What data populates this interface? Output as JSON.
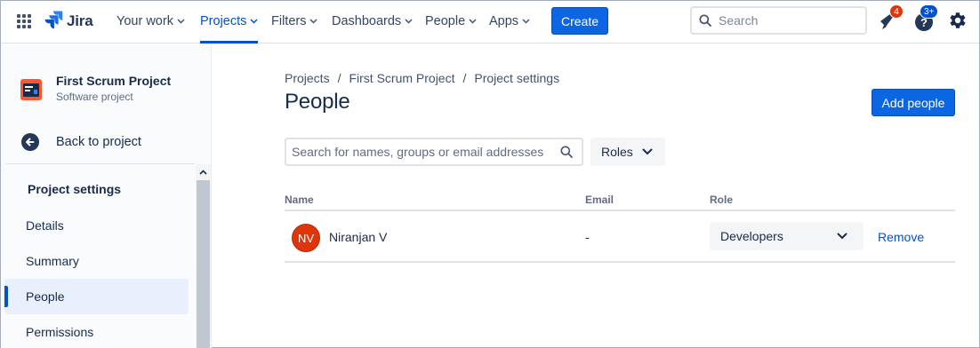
{
  "topnav": {
    "app_name": "Jira",
    "items": [
      {
        "label": "Your work",
        "active": false
      },
      {
        "label": "Projects",
        "active": true
      },
      {
        "label": "Filters",
        "active": false
      },
      {
        "label": "Dashboards",
        "active": false
      },
      {
        "label": "People",
        "active": false
      },
      {
        "label": "Apps",
        "active": false
      }
    ],
    "create_label": "Create",
    "search_placeholder": "Search",
    "notifications_badge": "4",
    "help_badge": "3+",
    "icons": [
      "app-switcher-icon",
      "jira-logo-icon",
      "search-icon",
      "notifications-icon",
      "help-icon",
      "settings-icon"
    ],
    "colors": {
      "accent": "#0c66e4",
      "notification_badge": "#de350b",
      "help_badge": "#0052cc"
    }
  },
  "sidebar": {
    "project_name": "First Scrum Project",
    "project_type": "Software project",
    "back_label": "Back to project",
    "section_heading": "Project settings",
    "items": [
      {
        "label": "Details",
        "selected": false
      },
      {
        "label": "Summary",
        "selected": false
      },
      {
        "label": "People",
        "selected": true
      },
      {
        "label": "Permissions",
        "selected": false
      }
    ]
  },
  "main": {
    "breadcrumbs": [
      "Projects",
      "First Scrum Project",
      "Project settings"
    ],
    "breadcrumb_separator": "/",
    "title": "People",
    "add_button_label": "Add people",
    "search_placeholder": "Search for names, groups or email addresses",
    "roles_filter_label": "Roles",
    "table": {
      "columns": [
        "Name",
        "Email",
        "Role"
      ],
      "rows": [
        {
          "initials": "NV",
          "name": "Niranjan V",
          "email": "-",
          "role": "Developers",
          "action": "Remove"
        }
      ]
    }
  }
}
